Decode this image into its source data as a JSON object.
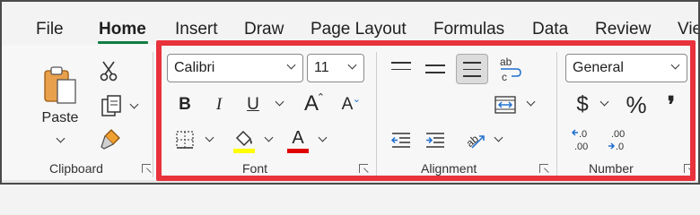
{
  "tabs": [
    {
      "label": "File"
    },
    {
      "label": "Home"
    },
    {
      "label": "Insert"
    },
    {
      "label": "Draw"
    },
    {
      "label": "Page Layout"
    },
    {
      "label": "Formulas"
    },
    {
      "label": "Data"
    },
    {
      "label": "Review"
    },
    {
      "label": "Vie"
    }
  ],
  "active_tab": "Home",
  "clipboard": {
    "paste_label": "Paste",
    "group_label": "Clipboard"
  },
  "font": {
    "family_value": "Calibri",
    "size_value": "11",
    "bold": "B",
    "italic": "I",
    "underline": "U",
    "grow": "A",
    "shrink": "A",
    "font_color_letter": "A",
    "fill_color": "#ffff00",
    "font_color": "#e00000",
    "group_label": "Font"
  },
  "alignment": {
    "wrap_text_glyph": "ab c",
    "group_label": "Alignment"
  },
  "number": {
    "format_value": "General",
    "currency_glyph": "$",
    "percent_glyph": "%",
    "comma_glyph": "❜",
    "inc_decimal": ".0 .00",
    "dec_decimal": ".00 .0",
    "group_label": "Number"
  },
  "colors": {
    "highlight_border": "#e8323c",
    "active_tab_underline": "#107c41",
    "arrow_blue": "#1f6fcf"
  },
  "icons": [
    "paste-icon",
    "cut-icon",
    "copy-icon",
    "format-painter-icon",
    "borders-icon",
    "fill-color-icon",
    "font-color-icon",
    "wrap-text-icon",
    "merge-center-icon",
    "orientation-icon",
    "indent-icon",
    "outdent-icon",
    "currency-icon",
    "percent-icon",
    "comma-icon",
    "increase-decimal-icon",
    "decrease-decimal-icon",
    "dialog-launcher-icon"
  ]
}
